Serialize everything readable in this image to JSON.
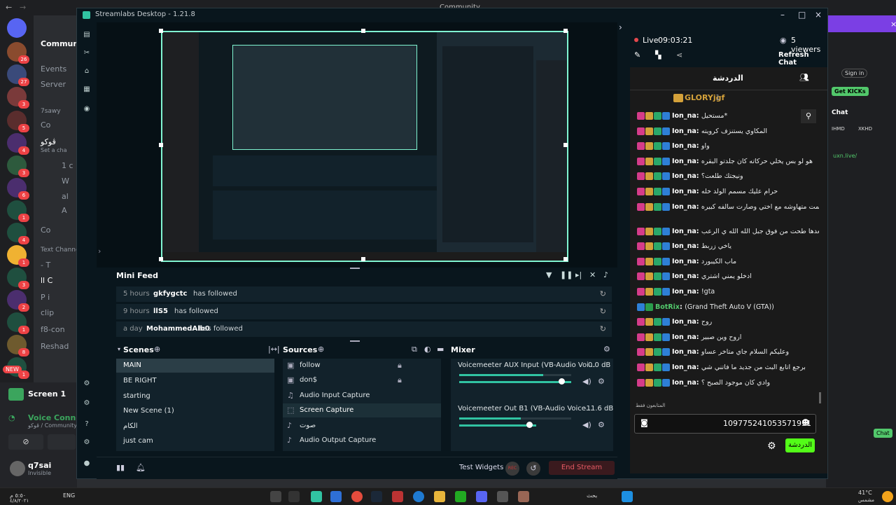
{
  "discord": {
    "top_title": "Community",
    "server_name": "Communi",
    "channels": [
      "Events",
      "Server",
      "7sawy",
      "Co",
      "ڤوكو",
      "Set a cha",
      "1 c",
      "W",
      "al",
      "A",
      "Co",
      "Text Channe",
      "- T",
      "ll C",
      "P i",
      "clip",
      "f8-con",
      "Reshad"
    ],
    "guild_badges": [
      "26",
      "27",
      "3",
      "5",
      "4",
      "3",
      "6",
      "1",
      "4",
      "1",
      "3",
      "2",
      "1",
      "8",
      "1"
    ],
    "new_badge": "NEW",
    "voice": {
      "screen_label": "Screen 1",
      "connected_label": "Voice Connect",
      "connected_sub": "ڤوكو / Community"
    },
    "user": {
      "name": "q7sai",
      "status": "Invisible"
    },
    "right_items": [
      "Sign in",
      "Get KICKs",
      "Chat",
      "IHMD",
      "11",
      "XKHD",
      "1",
      "uxn.live/",
      "Chat"
    ]
  },
  "taskbar": {
    "time": "٥:٥٠ م",
    "date": "٤/٨/٢٠٢١",
    "lang": "ENG",
    "search_label": "بحث",
    "weather_temp": "41°C",
    "weather_desc": "مشمس"
  },
  "streamlabs": {
    "window_title": "Streamlabs Desktop - 1.21.8",
    "mini_feed": {
      "title": "Mini Feed",
      "rows": [
        {
          "time": "5 hours",
          "name": "gkfygctc",
          "action": "has followed"
        },
        {
          "time": "9 hours",
          "name": "llS5",
          "action": "has followed"
        },
        {
          "time": "a day",
          "name": "MohammedAlb0",
          "action": "has followed"
        }
      ]
    },
    "scenes": {
      "title": "Scenes",
      "items": [
        "MAIN",
        "BE RIGHT",
        "starting",
        "New Scene (1)",
        "الكام",
        "just cam"
      ]
    },
    "sources": {
      "title": "Sources",
      "items": [
        "follow",
        "don$",
        "Audio Input Capture",
        "Screen Capture",
        "صوت",
        "Audio Output Capture"
      ]
    },
    "mixer": {
      "title": "Mixer",
      "channels": [
        {
          "name": "Voicemeeter AUX Input (VB-Audio Voi...",
          "db": "0.0 dB",
          "level": 0.75
        },
        {
          "name": "Voicemeeter Out B1 (VB-Audio Voice...",
          "db": "-11.6 dB",
          "level": 0.55
        }
      ]
    },
    "bottom": {
      "test_widgets": "Test Widgets",
      "rec": "REC",
      "end_stream": "End Stream"
    },
    "chat": {
      "live_label": "Live",
      "live_time": "09:03:21",
      "viewers": "5 viewers",
      "refresh": "Refresh Chat",
      "tab_label": "الدردشة",
      "pinned_user": "GLORYjgf",
      "pinned_count": "1",
      "messages": [
        {
          "user": "Ion_na",
          "text": "مستحيل*"
        },
        {
          "user": "Ion_na",
          "text": "المكاوي يستنزف كرويته"
        },
        {
          "user": "Ion_na",
          "text": "واو"
        },
        {
          "user": "Ion_na",
          "text": "هو لو بس يخلي حركاته كان جلدتو البقره"
        },
        {
          "user": "Ion_na",
          "text": "ونيجتك طلعت؟"
        },
        {
          "user": "Ion_na",
          "text": "حرام عليك مسمم الولد خله"
        },
        {
          "user": "Ion_na",
          "text": "يبوي يطلع ام الحلم اي يقدح حلمت متهاوشه مع اختي وصارت سالفه كبيره"
        },
        {
          "user": "Ion_na",
          "text": "وبعدها طحت من فوق جبل الله الله ي الرعب"
        },
        {
          "user": "Ion_na",
          "text": "ياخي زربط"
        },
        {
          "user": "Ion_na",
          "text": "ماب الكيبورد"
        },
        {
          "user": "Ion_na",
          "text": "ادخلو يمني اشتري"
        },
        {
          "user": "Ion_na",
          "text": "!gta"
        },
        {
          "user": "BotRix",
          "text": "(Grand Theft Auto V (GTA))"
        },
        {
          "user": "Ion_na",
          "text": "روح"
        },
        {
          "user": "Ion_na",
          "text": "اروح وين صبير"
        },
        {
          "user": "Ion_na",
          "text": "وعليكم السلام جاي متاخر عساو"
        },
        {
          "user": "Ion_na",
          "text": "برجع اتابع البث من جديد ما فاتني شي"
        },
        {
          "user": "Ion_na",
          "text": "وادي كان موجود الصبح ؟"
        }
      ],
      "followers_only": "المتابعون فقط",
      "input_value": "109775241053571951",
      "send_label": "الدردشة"
    }
  }
}
